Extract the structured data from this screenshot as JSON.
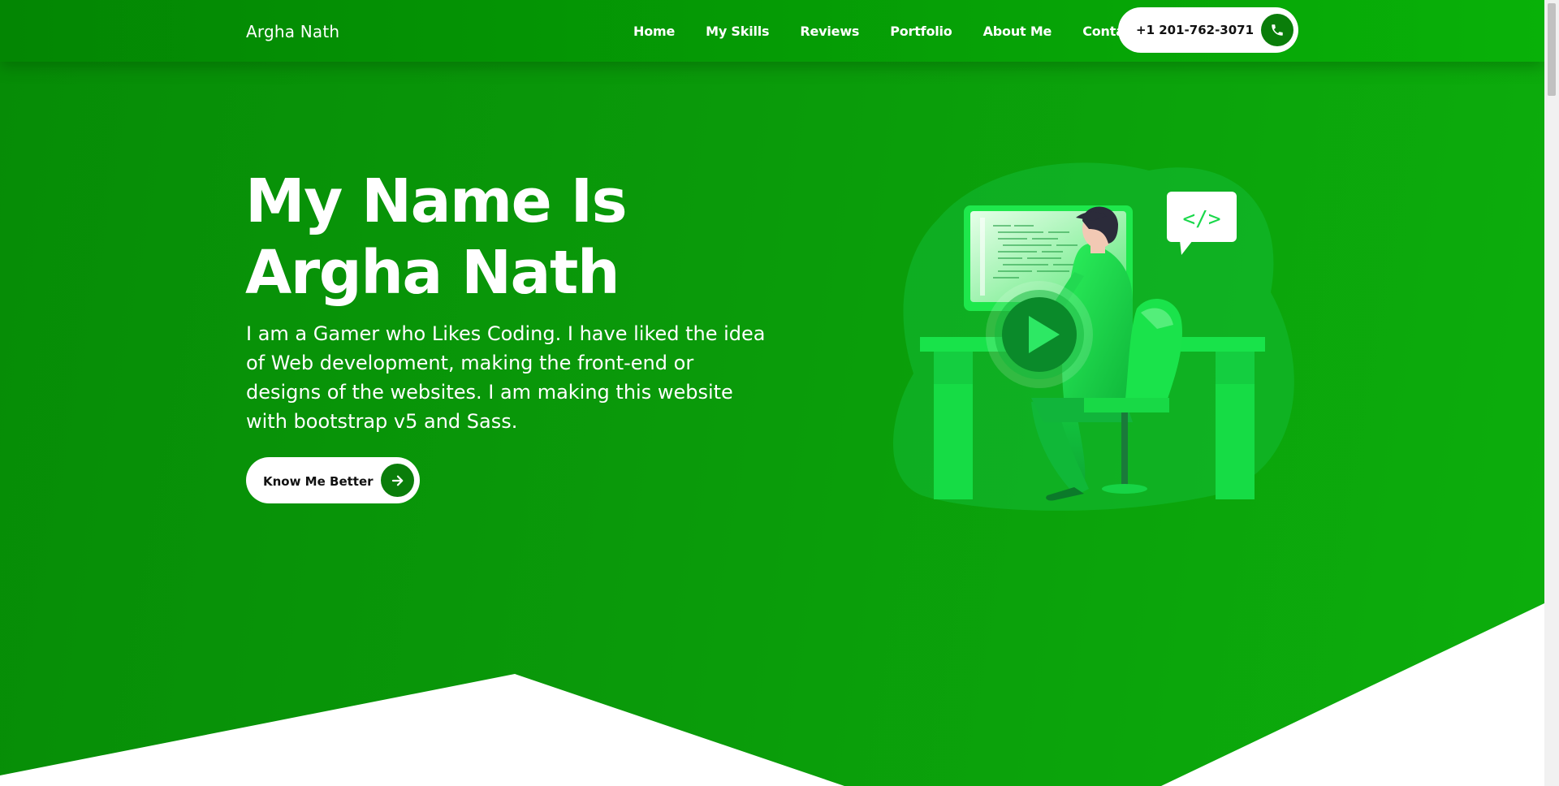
{
  "brand": {
    "name": "Argha Nath"
  },
  "nav": {
    "links": [
      {
        "label": "Home"
      },
      {
        "label": "My Skills"
      },
      {
        "label": "Reviews"
      },
      {
        "label": "Portfolio"
      },
      {
        "label": "About Me"
      },
      {
        "label": "Contact Me"
      }
    ],
    "phone": "+1 201-762-3071"
  },
  "hero": {
    "title_line1": "My Name Is",
    "title_line2": "Argha Nath",
    "description": "I am a Gamer who Likes Coding. I have liked the idea of Web development, making the front-end or designs of the websites. I am making this website with bootstrap v5 and Sass.",
    "cta_label": "Know Me Better",
    "code_bubble": "</>"
  },
  "icons": {
    "phone": "phone-icon",
    "cta": "arrow-right-icon",
    "play": "play-icon"
  },
  "colors": {
    "primary": "#0a9a0a",
    "accent_dark": "#0a7d0a",
    "accent_light": "#19e34a"
  }
}
